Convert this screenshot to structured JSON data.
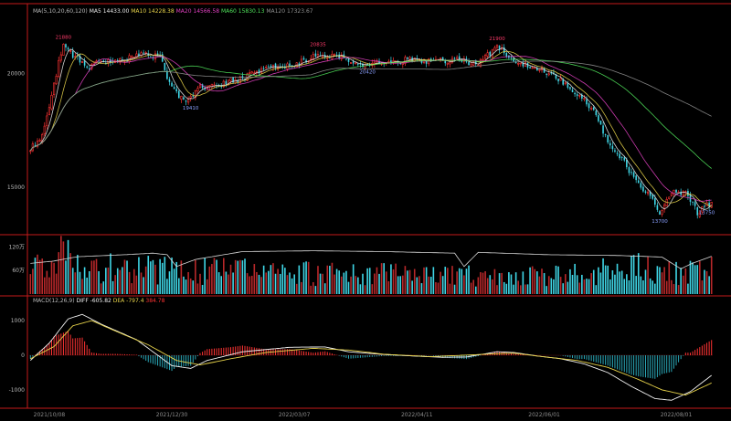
{
  "colors": {
    "up": "#ff3333",
    "down": "#3fd6e6",
    "grid": "#c41a1a",
    "grid_dim": "#5a0d0d",
    "text": "#b9b9b9",
    "ma5": "#e8e8e8",
    "ma10": "#e6d24a",
    "ma20": "#e040c0",
    "ma60": "#4fe05a",
    "ma120": "#909090",
    "dif": "#f2f2f2",
    "dea": "#e6d24a",
    "marker_red": "#ff3b6b",
    "marker_blue": "#8aa0ff"
  },
  "price_panel": {
    "legend": [
      {
        "text": "MA(5,10,20,60,120)",
        "color": "#b9b9b9"
      },
      {
        "text": "MA5 14433.00",
        "color": "#e8e8e8"
      },
      {
        "text": "MA10 14228.38",
        "color": "#e6d24a"
      },
      {
        "text": "MA20 14566.58",
        "color": "#e040c0"
      },
      {
        "text": "MA60 15830.13",
        "color": "#4fe05a"
      },
      {
        "text": "MA120 17323.67",
        "color": "#909090"
      }
    ],
    "y_ticks": [
      {
        "v": 20000,
        "label": "20000"
      },
      {
        "v": 15000,
        "label": "15000"
      }
    ],
    "annotations": [
      {
        "text": "21880",
        "i": 14,
        "kind": "high"
      },
      {
        "text": "19410",
        "i": 68,
        "kind": "low"
      },
      {
        "text": "20835",
        "i": 122,
        "kind": "high"
      },
      {
        "text": "20420",
        "i": 143,
        "kind": "low"
      },
      {
        "text": "21900",
        "i": 198,
        "kind": "high"
      },
      {
        "text": "13700",
        "i": 267,
        "kind": "low"
      },
      {
        "text": "13750",
        "i": 287,
        "kind": "low"
      }
    ]
  },
  "volume_panel": {
    "y_ticks": [
      {
        "v": 1200000,
        "label": "120万"
      },
      {
        "v": 600000,
        "label": "60万"
      }
    ]
  },
  "macd_panel": {
    "legend": [
      {
        "text": "MACD(12,26,9)",
        "color": "#b9b9b9"
      },
      {
        "text": "DIFF -605.82",
        "color": "#f2f2f2"
      },
      {
        "text": "DEA -797.4",
        "color": "#e6d24a"
      },
      {
        "text": "384.78",
        "color": "#ff3333"
      }
    ],
    "y_ticks": [
      {
        "v": 1000,
        "label": "1000"
      },
      {
        "v": 0,
        "label": "0"
      },
      {
        "v": -1000,
        "label": "-1000"
      }
    ]
  },
  "x_dates": [
    {
      "label": "2021/10/08",
      "i": 8
    },
    {
      "label": "2021/12/30",
      "i": 60
    },
    {
      "label": "2022/03/07",
      "i": 112
    },
    {
      "label": "2022/04/11",
      "i": 164
    },
    {
      "label": "2022/06/01",
      "i": 218
    },
    {
      "label": "2022/08/01",
      "i": 274
    }
  ],
  "chart_data": {
    "type": "candlestick",
    "n": 290,
    "anchors": {
      "close": [
        [
          0,
          16700
        ],
        [
          5,
          17300
        ],
        [
          10,
          19500
        ],
        [
          14,
          21400
        ],
        [
          18,
          20800
        ],
        [
          24,
          20300
        ],
        [
          30,
          20500
        ],
        [
          40,
          20600
        ],
        [
          48,
          20900
        ],
        [
          55,
          20700
        ],
        [
          60,
          19300
        ],
        [
          66,
          18700
        ],
        [
          72,
          19400
        ],
        [
          80,
          19500
        ],
        [
          90,
          19800
        ],
        [
          100,
          20200
        ],
        [
          112,
          20400
        ],
        [
          122,
          20800
        ],
        [
          132,
          20700
        ],
        [
          142,
          20300
        ],
        [
          148,
          20500
        ],
        [
          160,
          20600
        ],
        [
          170,
          20500
        ],
        [
          180,
          20600
        ],
        [
          190,
          20400
        ],
        [
          198,
          21200
        ],
        [
          206,
          20500
        ],
        [
          214,
          20300
        ],
        [
          222,
          19900
        ],
        [
          230,
          19300
        ],
        [
          238,
          18500
        ],
        [
          244,
          17200
        ],
        [
          250,
          16400
        ],
        [
          256,
          15400
        ],
        [
          262,
          14700
        ],
        [
          267,
          13900
        ],
        [
          272,
          14800
        ],
        [
          278,
          14800
        ],
        [
          283,
          13900
        ],
        [
          286,
          14200
        ],
        [
          289,
          14300
        ]
      ],
      "volume": [
        [
          0,
          600000
        ],
        [
          8,
          900000
        ],
        [
          14,
          1100000
        ],
        [
          20,
          800000
        ],
        [
          40,
          700000
        ],
        [
          60,
          650000
        ],
        [
          80,
          650000
        ],
        [
          100,
          600000
        ],
        [
          140,
          550000
        ],
        [
          180,
          520000
        ],
        [
          200,
          480000
        ],
        [
          220,
          500000
        ],
        [
          240,
          600000
        ],
        [
          260,
          780000
        ],
        [
          275,
          650000
        ],
        [
          289,
          700000
        ]
      ],
      "oi": [
        [
          0,
          780000
        ],
        [
          10,
          840000
        ],
        [
          20,
          950000
        ],
        [
          40,
          1000000
        ],
        [
          52,
          1040000
        ],
        [
          58,
          1000000
        ],
        [
          62,
          700000
        ],
        [
          70,
          880000
        ],
        [
          90,
          1080000
        ],
        [
          120,
          1100000
        ],
        [
          150,
          1080000
        ],
        [
          180,
          1040000
        ],
        [
          184,
          700000
        ],
        [
          190,
          1060000
        ],
        [
          220,
          1000000
        ],
        [
          250,
          980000
        ],
        [
          268,
          940000
        ],
        [
          276,
          640000
        ],
        [
          280,
          760000
        ],
        [
          289,
          960000
        ]
      ],
      "dif": [
        [
          0,
          -150
        ],
        [
          8,
          350
        ],
        [
          16,
          1050
        ],
        [
          22,
          1180
        ],
        [
          30,
          900
        ],
        [
          45,
          450
        ],
        [
          60,
          -300
        ],
        [
          68,
          -380
        ],
        [
          75,
          -150
        ],
        [
          90,
          100
        ],
        [
          110,
          230
        ],
        [
          125,
          240
        ],
        [
          135,
          100
        ],
        [
          150,
          20
        ],
        [
          165,
          -30
        ],
        [
          175,
          -60
        ],
        [
          185,
          -50
        ],
        [
          198,
          100
        ],
        [
          205,
          80
        ],
        [
          215,
          -20
        ],
        [
          225,
          -100
        ],
        [
          235,
          -250
        ],
        [
          245,
          -500
        ],
        [
          255,
          -900
        ],
        [
          265,
          -1250
        ],
        [
          272,
          -1300
        ],
        [
          280,
          -1050
        ],
        [
          289,
          -580
        ]
      ],
      "dea": [
        [
          0,
          -100
        ],
        [
          10,
          250
        ],
        [
          18,
          850
        ],
        [
          26,
          1000
        ],
        [
          36,
          700
        ],
        [
          50,
          300
        ],
        [
          62,
          -150
        ],
        [
          72,
          -280
        ],
        [
          85,
          -100
        ],
        [
          100,
          80
        ],
        [
          120,
          200
        ],
        [
          135,
          150
        ],
        [
          150,
          30
        ],
        [
          170,
          -40
        ],
        [
          190,
          20
        ],
        [
          205,
          60
        ],
        [
          220,
          -60
        ],
        [
          232,
          -150
        ],
        [
          245,
          -350
        ],
        [
          258,
          -700
        ],
        [
          268,
          -1000
        ],
        [
          278,
          -1150
        ],
        [
          289,
          -800
        ]
      ]
    },
    "ma_periods": [
      5,
      10,
      20,
      60,
      120
    ],
    "price_range": [
      13000,
      22500
    ],
    "volume_range": [
      0,
      1300000
    ],
    "macd_range": [
      -1450,
      1450
    ]
  }
}
